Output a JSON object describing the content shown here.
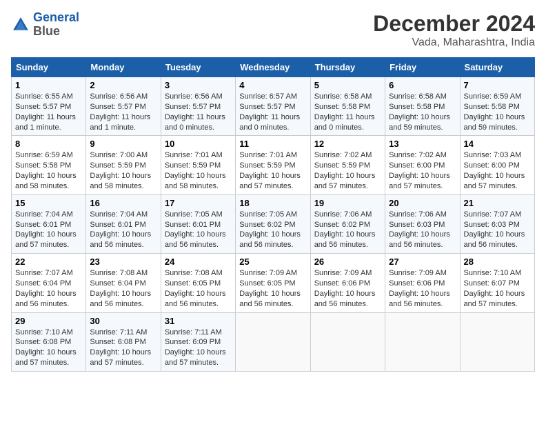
{
  "logo": {
    "line1": "General",
    "line2": "Blue"
  },
  "title": "December 2024",
  "subtitle": "Vada, Maharashtra, India",
  "days_header": [
    "Sunday",
    "Monday",
    "Tuesday",
    "Wednesday",
    "Thursday",
    "Friday",
    "Saturday"
  ],
  "weeks": [
    [
      {
        "num": "1",
        "sunrise": "6:55 AM",
        "sunset": "5:57 PM",
        "daylight": "11 hours and 1 minute."
      },
      {
        "num": "2",
        "sunrise": "6:56 AM",
        "sunset": "5:57 PM",
        "daylight": "11 hours and 1 minute."
      },
      {
        "num": "3",
        "sunrise": "6:56 AM",
        "sunset": "5:57 PM",
        "daylight": "11 hours and 0 minutes."
      },
      {
        "num": "4",
        "sunrise": "6:57 AM",
        "sunset": "5:57 PM",
        "daylight": "11 hours and 0 minutes."
      },
      {
        "num": "5",
        "sunrise": "6:58 AM",
        "sunset": "5:58 PM",
        "daylight": "11 hours and 0 minutes."
      },
      {
        "num": "6",
        "sunrise": "6:58 AM",
        "sunset": "5:58 PM",
        "daylight": "10 hours and 59 minutes."
      },
      {
        "num": "7",
        "sunrise": "6:59 AM",
        "sunset": "5:58 PM",
        "daylight": "10 hours and 59 minutes."
      }
    ],
    [
      {
        "num": "8",
        "sunrise": "6:59 AM",
        "sunset": "5:58 PM",
        "daylight": "10 hours and 58 minutes."
      },
      {
        "num": "9",
        "sunrise": "7:00 AM",
        "sunset": "5:59 PM",
        "daylight": "10 hours and 58 minutes."
      },
      {
        "num": "10",
        "sunrise": "7:01 AM",
        "sunset": "5:59 PM",
        "daylight": "10 hours and 58 minutes."
      },
      {
        "num": "11",
        "sunrise": "7:01 AM",
        "sunset": "5:59 PM",
        "daylight": "10 hours and 57 minutes."
      },
      {
        "num": "12",
        "sunrise": "7:02 AM",
        "sunset": "5:59 PM",
        "daylight": "10 hours and 57 minutes."
      },
      {
        "num": "13",
        "sunrise": "7:02 AM",
        "sunset": "6:00 PM",
        "daylight": "10 hours and 57 minutes."
      },
      {
        "num": "14",
        "sunrise": "7:03 AM",
        "sunset": "6:00 PM",
        "daylight": "10 hours and 57 minutes."
      }
    ],
    [
      {
        "num": "15",
        "sunrise": "7:04 AM",
        "sunset": "6:01 PM",
        "daylight": "10 hours and 57 minutes."
      },
      {
        "num": "16",
        "sunrise": "7:04 AM",
        "sunset": "6:01 PM",
        "daylight": "10 hours and 56 minutes."
      },
      {
        "num": "17",
        "sunrise": "7:05 AM",
        "sunset": "6:01 PM",
        "daylight": "10 hours and 56 minutes."
      },
      {
        "num": "18",
        "sunrise": "7:05 AM",
        "sunset": "6:02 PM",
        "daylight": "10 hours and 56 minutes."
      },
      {
        "num": "19",
        "sunrise": "7:06 AM",
        "sunset": "6:02 PM",
        "daylight": "10 hours and 56 minutes."
      },
      {
        "num": "20",
        "sunrise": "7:06 AM",
        "sunset": "6:03 PM",
        "daylight": "10 hours and 56 minutes."
      },
      {
        "num": "21",
        "sunrise": "7:07 AM",
        "sunset": "6:03 PM",
        "daylight": "10 hours and 56 minutes."
      }
    ],
    [
      {
        "num": "22",
        "sunrise": "7:07 AM",
        "sunset": "6:04 PM",
        "daylight": "10 hours and 56 minutes."
      },
      {
        "num": "23",
        "sunrise": "7:08 AM",
        "sunset": "6:04 PM",
        "daylight": "10 hours and 56 minutes."
      },
      {
        "num": "24",
        "sunrise": "7:08 AM",
        "sunset": "6:05 PM",
        "daylight": "10 hours and 56 minutes."
      },
      {
        "num": "25",
        "sunrise": "7:09 AM",
        "sunset": "6:05 PM",
        "daylight": "10 hours and 56 minutes."
      },
      {
        "num": "26",
        "sunrise": "7:09 AM",
        "sunset": "6:06 PM",
        "daylight": "10 hours and 56 minutes."
      },
      {
        "num": "27",
        "sunrise": "7:09 AM",
        "sunset": "6:06 PM",
        "daylight": "10 hours and 56 minutes."
      },
      {
        "num": "28",
        "sunrise": "7:10 AM",
        "sunset": "6:07 PM",
        "daylight": "10 hours and 57 minutes."
      }
    ],
    [
      {
        "num": "29",
        "sunrise": "7:10 AM",
        "sunset": "6:08 PM",
        "daylight": "10 hours and 57 minutes."
      },
      {
        "num": "30",
        "sunrise": "7:11 AM",
        "sunset": "6:08 PM",
        "daylight": "10 hours and 57 minutes."
      },
      {
        "num": "31",
        "sunrise": "7:11 AM",
        "sunset": "6:09 PM",
        "daylight": "10 hours and 57 minutes."
      },
      null,
      null,
      null,
      null
    ]
  ],
  "labels": {
    "sunrise": "Sunrise:",
    "sunset": "Sunset:",
    "daylight": "Daylight hours"
  },
  "colors": {
    "header_bg": "#1a5fa8",
    "logo_blue": "#1a5fa8"
  }
}
